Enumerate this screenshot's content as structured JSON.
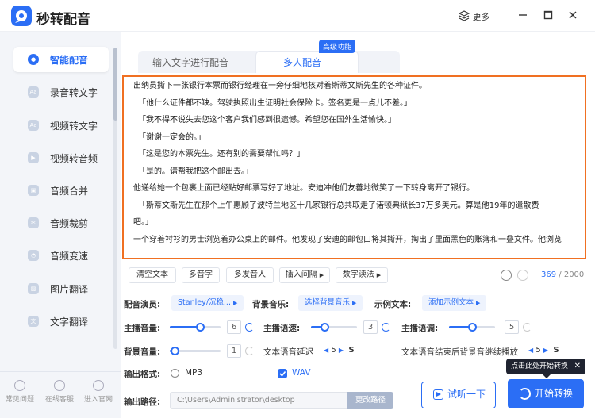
{
  "app": {
    "title": "秒转配音",
    "more_label": "更多"
  },
  "sidebar": {
    "items": [
      {
        "label": "智能配音",
        "icon": "voice-icon",
        "active": true
      },
      {
        "label": "录音转文字",
        "icon": "record-icon"
      },
      {
        "label": "视频转文字",
        "icon": "video-text-icon"
      },
      {
        "label": "视频转音频",
        "icon": "video-audio-icon"
      },
      {
        "label": "音频合并",
        "icon": "merge-icon"
      },
      {
        "label": "音频裁剪",
        "icon": "crop-icon"
      },
      {
        "label": "音频变速",
        "icon": "speed-icon"
      },
      {
        "label": "图片翻译",
        "icon": "image-translate-icon"
      },
      {
        "label": "文字翻译",
        "icon": "text-translate-icon"
      }
    ],
    "bottom": [
      {
        "label": "常见问题",
        "icon": "help-icon"
      },
      {
        "label": "在线客服",
        "icon": "service-icon"
      },
      {
        "label": "进入官网",
        "icon": "website-icon"
      }
    ]
  },
  "tabs": [
    {
      "label": "输入文字进行配音"
    },
    {
      "label": "多人配音",
      "active": true
    }
  ],
  "badge": "高级功能",
  "editor": {
    "lines": [
      "出纳员撕下一张银行本票而银行经理在一旁仔细地核对着斯蒂文斯先生的各种证件。",
      "「他什么证件都不缺。驾驶执照出生证明社会保险卡。签名更是一点儿不差。」",
      "「我不得不说失去您这个客户我们感到很遗憾。希望您在国外生活愉快。」",
      "「谢谢一定会的。」",
      "「这是您的本票先生。还有别的需要帮忙吗？」",
      "「是的。请帮我把这个邮出去。」",
      "他递给她一个包裹上面已经贴好邮票写好了地址。安迪冲他们友善地微笑了一下转身离开了银行。",
      "「斯蒂文斯先生在那个上午惠顾了波特兰地区十几家银行总共取走了诺顿典狱长37万多美元。算是他19年的遣散费",
      "吧。」",
      "一个穿着衬衫的男士浏览着办公桌上的邮件。他发现了安迪的邮包口将其撕开，掏出了里面黑色的账簿和一叠文件。他浏览"
    ]
  },
  "toolbar": {
    "clear": "清空文本",
    "polyphone": "多音字",
    "multi_speaker": "多发音人",
    "insert_pause": "插入间隔",
    "number_read": "数字读法",
    "count": "369",
    "max": "/ 2000"
  },
  "settings": {
    "voice_label": "配音演员:",
    "voice_value": "Stanley/沉稳...",
    "bgm_label": "背景音乐:",
    "bgm_value": "选择背景音乐",
    "sample_label": "示例文本:",
    "sample_value": "添加示例文本",
    "host_volume_label": "主播音量:",
    "host_volume": "6",
    "host_speed_label": "主播语速:",
    "host_speed": "3",
    "host_tone_label": "主播语调:",
    "host_tone": "5",
    "bg_volume_label": "背景音量:",
    "bg_volume": "1",
    "delay_label": "文本语音延迟",
    "delay_value": "5",
    "delay_unit": "S",
    "after_label": "文本语音结束后背景音继续播放",
    "after_value": "5",
    "after_unit": "S",
    "levels": {
      "host_volume": 0.6,
      "host_speed": 0.3,
      "host_tone": 0.5,
      "bg_volume": 0.1
    }
  },
  "output": {
    "format_label": "输出格式:",
    "mp3": "MP3",
    "wav": "WAV",
    "path_label": "输出路径:",
    "path": "C:\\Users\\Administrator\\desktop",
    "change_path": "更改路径"
  },
  "actions": {
    "listen": "试听一下",
    "start": "开始转换",
    "tip": "点击此处开始转换",
    "tip_close": "✕"
  },
  "colors": {
    "accent": "#2b6ef5",
    "editor_border": "#f07022"
  }
}
